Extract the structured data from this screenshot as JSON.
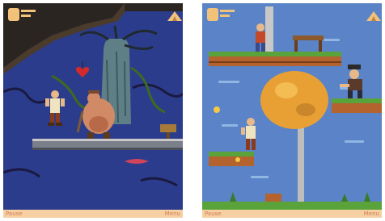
{
  "screens": [
    {
      "id": "cave-scene",
      "background_color": "#2c3c8c",
      "hud": {
        "lives_icon": "head-icon",
        "home_icon": "camp-tent-icon"
      },
      "softkeys": {
        "left": "Pause",
        "right": "Menu"
      }
    },
    {
      "id": "sky-scene",
      "background_color": "#5a84c7",
      "hud": {
        "lives_icon": "head-icon",
        "home_icon": "camp-tent-icon"
      },
      "softkeys": {
        "left": "Pause",
        "right": "Menu"
      }
    }
  ]
}
